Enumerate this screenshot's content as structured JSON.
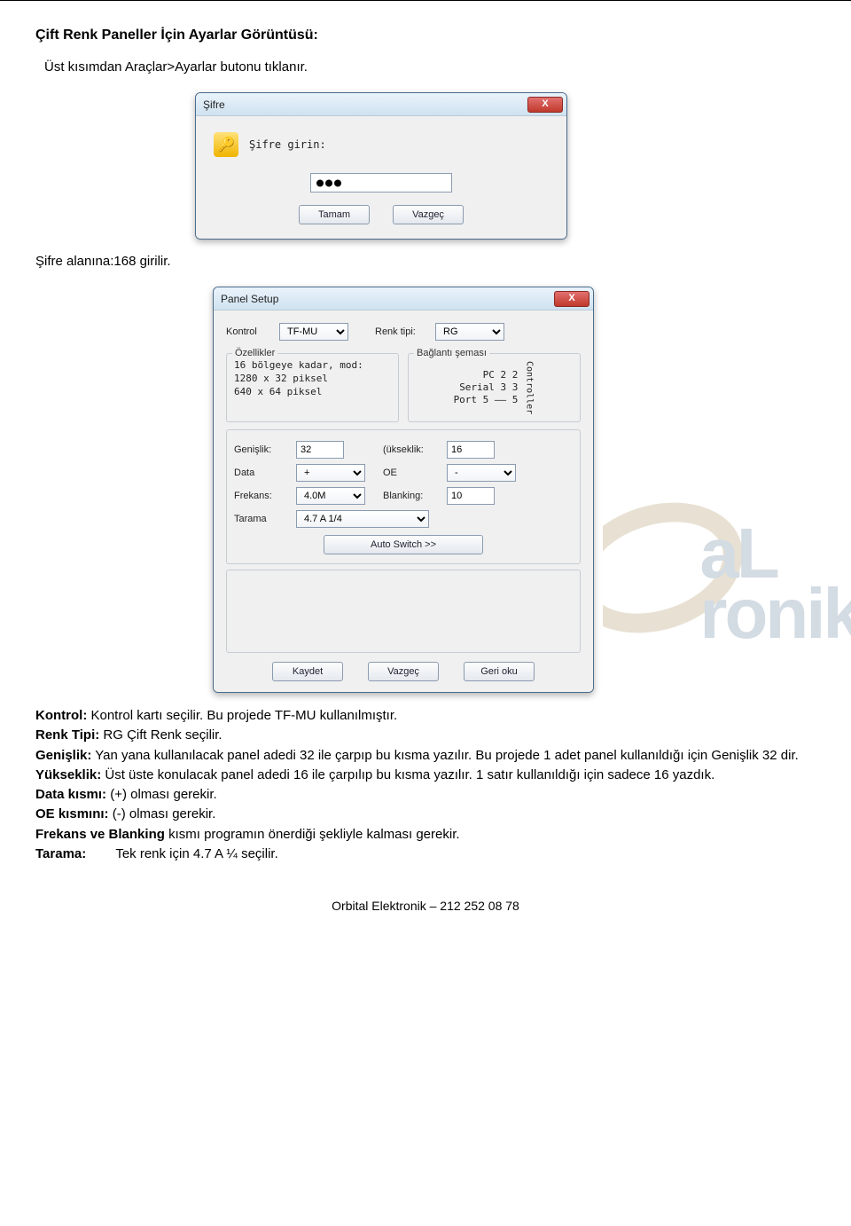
{
  "doc": {
    "heading": "Çift Renk Paneller İçin Ayarlar Görüntüsü:",
    "intro": "Üst kısımdan Araçlar>Ayarlar butonu tıklanır.",
    "after_password": "Şifre alanına:168 girilir."
  },
  "password_dialog": {
    "title": "Şifre",
    "close_x": "X",
    "prompt": "Şifre girin:",
    "masked": "●●●",
    "ok": "Tamam",
    "cancel": "Vazgeç"
  },
  "panel_dialog": {
    "title": "Panel Setup",
    "close_x": "X",
    "kontrol_label": "Kontrol",
    "kontrol_value": "TF-MU",
    "renk_label": "Renk tipi:",
    "renk_value": "RG",
    "ozellikler_title": "Özellikler",
    "ozellikler_body": "16 bölgeye kadar, mod:\n1280 x 32 piksel\n 640 x 64 piksel",
    "baglanti_title": "Bağlantı şeması",
    "diagram_line1": "PC   2    2",
    "diagram_line2": "Serial 3    3",
    "diagram_line3": "Port 5 —— 5",
    "diagram_side": "Controller",
    "genislik_label": "Genişlik:",
    "genislik_value": "32",
    "yukseklik_label": "(ükseklik:",
    "yukseklik_value": "16",
    "data_label": "Data",
    "data_value": "+",
    "oe_label": "OE",
    "oe_value": "-",
    "frekans_label": "Frekans:",
    "frekans_value": "4.0M",
    "blanking_label": "Blanking:",
    "blanking_value": "10",
    "tarama_label": "Tarama",
    "tarama_value": "4.7 A 1/4",
    "auto_switch": "Auto Switch >>",
    "save": "Kaydet",
    "cancel": "Vazgeç",
    "read": "Geri oku"
  },
  "explain": {
    "p1a": "Kontrol:",
    "p1b": " Kontrol kartı seçilir. Bu projede TF-MU kullanılmıştır.",
    "p2a": "Renk Tipi:",
    "p2b": " RG Çift Renk seçilir.",
    "p3a": "Genişlik:",
    "p3b": " Yan yana kullanılacak panel adedi 32 ile çarpıp bu kısma yazılır. Bu projede 1 adet panel kullanıldığı için Genişlik 32 dir.",
    "p4a": "Yükseklik:",
    "p4b": " Üst üste konulacak panel adedi 16 ile çarpılıp bu kısma yazılır. 1 satır kullanıldığı için sadece 16 yazdık.",
    "p5a": "Data kısmı:",
    "p5b": " (+) olması gerekir.",
    "p6a": "OE kısmını:",
    "p6b": " (-) olması gerekir.",
    "p7a": "Frekans ve Blanking",
    "p7b": " kısmı programın önerdiği şekliyle kalması gerekir.",
    "p8a": "Tarama:",
    "p8b": "        Tek renk için 4.7 A ¼ seçilir."
  },
  "footer": "Orbital Elektronik – 212 252 08 78",
  "watermark": {
    "line1": "aL",
    "line2": "ronik"
  }
}
